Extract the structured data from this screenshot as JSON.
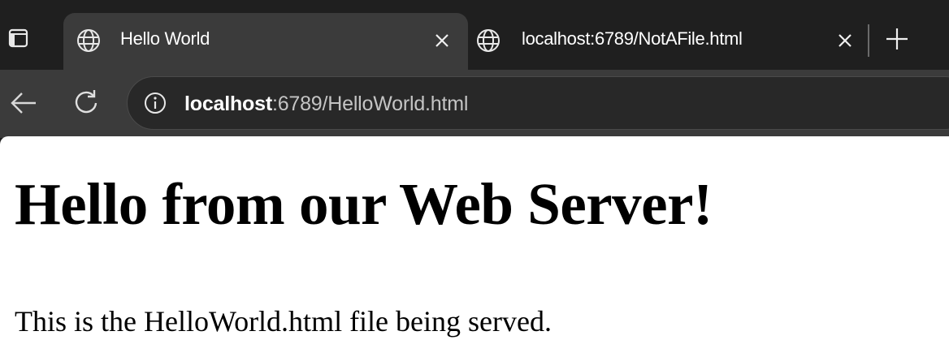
{
  "browser": {
    "tabs": [
      {
        "title": "Hello World",
        "icon": "globe-icon",
        "active": true
      },
      {
        "title": "localhost:6789/NotAFile.html",
        "icon": "globe-icon",
        "active": false
      }
    ],
    "address_bar": {
      "host": "localhost",
      "path": ":6789/HelloWorld.html"
    },
    "colors": {
      "chrome": "#1f1f1f",
      "active_tab": "#3b3b3b",
      "page": "#ffffff"
    }
  },
  "page": {
    "heading": "Hello from our Web Server!",
    "paragraph": "This is the HelloWorld.html file being served."
  }
}
